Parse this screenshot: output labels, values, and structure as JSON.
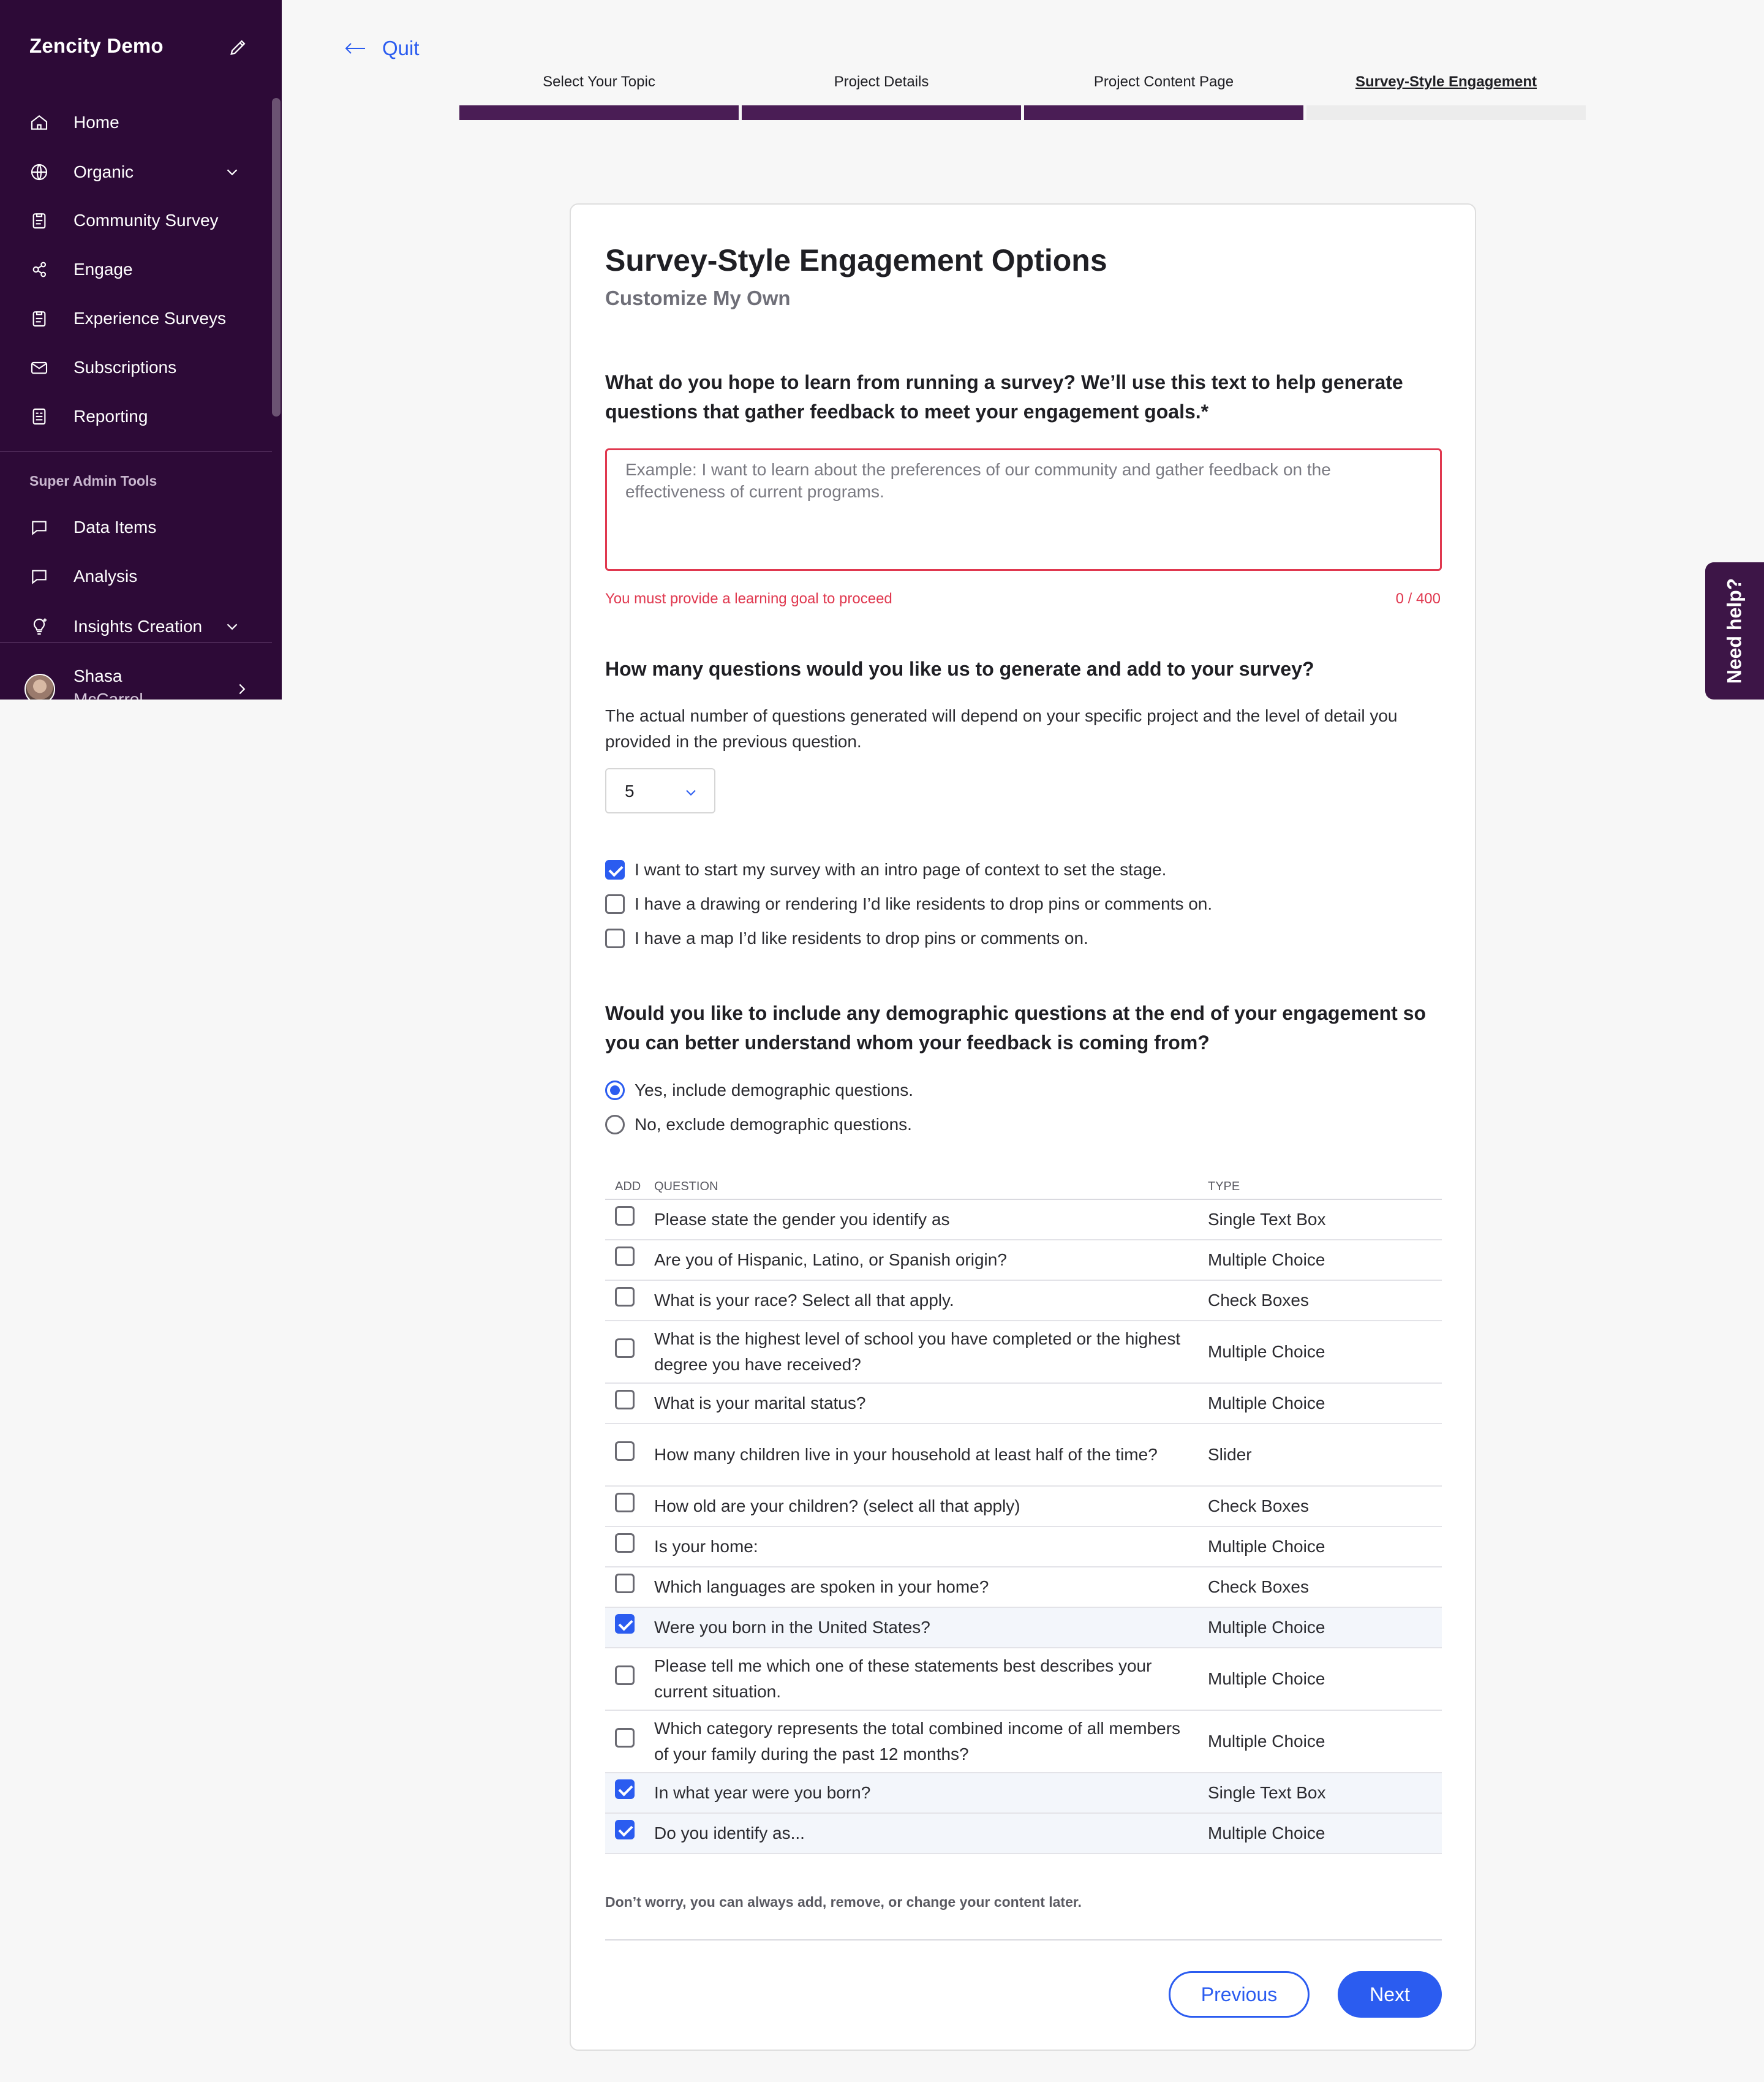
{
  "sidebar": {
    "brand": "Zencity Demo",
    "items": [
      {
        "label": "Home",
        "icon": "home-icon"
      },
      {
        "label": "Organic",
        "icon": "globe-icon",
        "expandable": true
      },
      {
        "label": "Community Survey",
        "icon": "survey-icon"
      },
      {
        "label": "Engage",
        "icon": "engage-icon"
      },
      {
        "label": "Experience Surveys",
        "icon": "survey-icon"
      },
      {
        "label": "Subscriptions",
        "icon": "mail-icon"
      },
      {
        "label": "Reporting",
        "icon": "report-icon"
      }
    ],
    "section_title": "Super Admin Tools",
    "admin_items": [
      {
        "label": "Data Items",
        "icon": "chat-icon"
      },
      {
        "label": "Analysis",
        "icon": "chat-icon"
      },
      {
        "label": "Insights Creation",
        "icon": "bulb-icon",
        "expandable": true
      }
    ],
    "user": {
      "name": "Shasa",
      "sub": "McCarrel"
    }
  },
  "need_help": "Need help?",
  "quit_label": "Quit",
  "stepper": {
    "steps": [
      {
        "label": "Select Your Topic",
        "state": "done"
      },
      {
        "label": "Project Details",
        "state": "done"
      },
      {
        "label": "Project Content Page",
        "state": "done"
      },
      {
        "label": "Survey-Style Engagement",
        "state": "current"
      }
    ]
  },
  "card": {
    "title": "Survey-Style Engagement Options",
    "subtitle": "Customize My Own",
    "learn_question": "What do you hope to learn from running a survey? We’ll use this text to help generate questions that gather feedback to meet your engagement goals.*",
    "learn_placeholder": "Example: I want to learn about the preferences of our community and gather feedback on the effectiveness of current programs.",
    "learn_value": "",
    "learn_error": "You must provide a learning goal to proceed",
    "learn_count": "0 / 400",
    "count_question": "How many questions would you like us to generate and add to your survey?",
    "count_help": "The actual number of questions generated will depend on your specific project and the level of detail you provided in the previous question.",
    "count_value": "5",
    "options": [
      {
        "label": "I want to start my survey with an intro page of context to set the stage.",
        "checked": true
      },
      {
        "label": "I have a drawing or rendering I’d like residents to drop pins or comments on.",
        "checked": false
      },
      {
        "label": "I have a map I’d like residents to drop pins or comments on.",
        "checked": false
      }
    ],
    "demo_question": "Would you like to include any demographic questions at the end of your engagement so you can better understand whom your feedback is coming from?",
    "demo_radios": [
      {
        "label": "Yes, include demographic questions.",
        "checked": true
      },
      {
        "label": "No, exclude demographic questions.",
        "checked": false
      }
    ],
    "table": {
      "headers": {
        "add": "ADD",
        "question": "QUESTION",
        "type": "TYPE"
      },
      "rows": [
        {
          "question": "Please state the gender you identify as",
          "type": "Single Text Box",
          "checked": false
        },
        {
          "question": "Are you of Hispanic, Latino, or Spanish origin?",
          "type": "Multiple Choice",
          "checked": false
        },
        {
          "question": "What is your race? Select all that apply.",
          "type": "Check Boxes",
          "checked": false
        },
        {
          "question": "What is the highest level of school you have completed or the highest degree you have received?",
          "type": "Multiple Choice",
          "checked": false
        },
        {
          "question": "What is your marital status?",
          "type": "Multiple Choice",
          "checked": false
        },
        {
          "question": "How many children live in your household at least half of the time?",
          "type": "Slider",
          "checked": false
        },
        {
          "question": "How old are your children? (select all that apply)",
          "type": "Check Boxes",
          "checked": false
        },
        {
          "question": "Is your home:",
          "type": "Multiple Choice",
          "checked": false
        },
        {
          "question": "Which languages are spoken in your home?",
          "type": "Check Boxes",
          "checked": false
        },
        {
          "question": "Were you born in the United States?",
          "type": "Multiple Choice",
          "checked": true
        },
        {
          "question": "Please tell me which one of these statements best describes your current situation.",
          "type": "Multiple Choice",
          "checked": false
        },
        {
          "question": "Which category represents the total combined income of all members of your family during the past 12 months?",
          "type": "Multiple Choice",
          "checked": false
        },
        {
          "question": "In what year were you born?",
          "type": "Single Text Box",
          "checked": true
        },
        {
          "question": "Do you identify as...",
          "type": "Multiple Choice",
          "checked": true
        }
      ]
    },
    "note": "Don’t worry, you can always add, remove, or change your content later.",
    "previous_label": "Previous",
    "next_label": "Next"
  },
  "colors": {
    "sidebar": "#2d0a37",
    "accent": "#2b5cf0",
    "error": "#e0384f",
    "step_done": "#4a1d55"
  }
}
